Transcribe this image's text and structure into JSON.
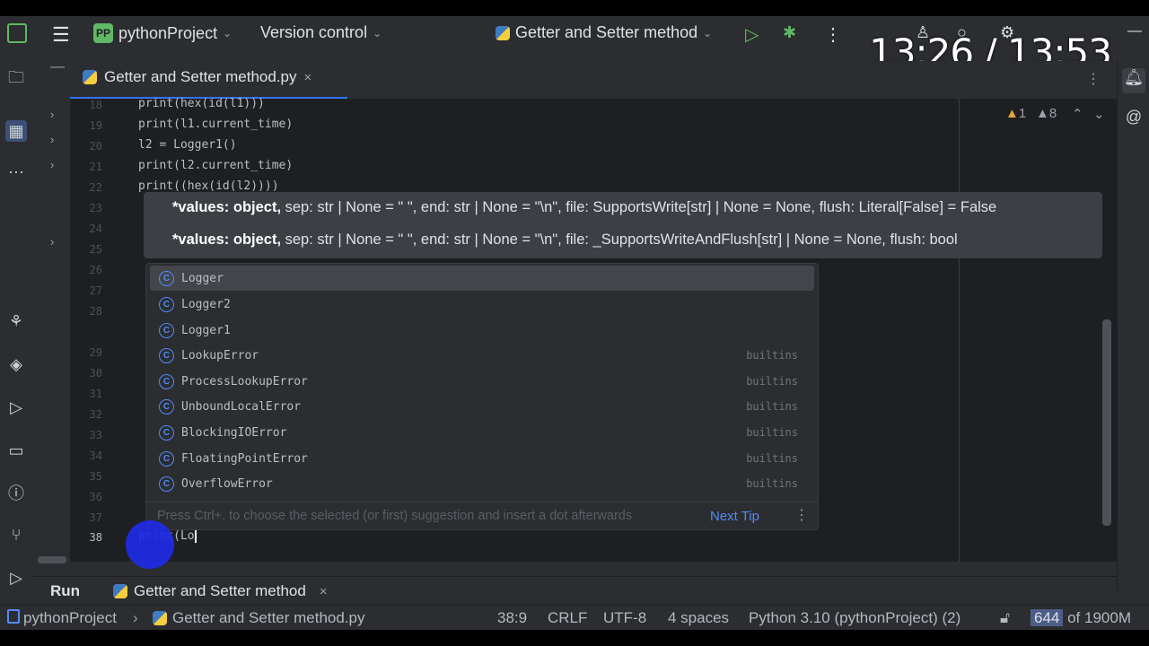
{
  "titlebar": {
    "project_badge": "PP",
    "project_name": "pythonProject",
    "version_control": "Version control",
    "run_config": "Getter and Setter method",
    "timer": "13:26 / 13:53"
  },
  "editor_tab": {
    "label": "Getter and Setter method.py",
    "close": "×"
  },
  "inspections": {
    "warnings": "1",
    "weak_warnings": "8"
  },
  "line_numbers": [
    "18",
    "19",
    "20",
    "21",
    "22",
    "23",
    "24",
    "25",
    "26",
    "27",
    "28",
    "29",
    "30",
    "31",
    "32",
    "33",
    "34",
    "35",
    "36",
    "37",
    "38"
  ],
  "code_lines": [
    "print(hex(id(l1)))",
    "print(l1.current_time)",
    "l2 = Logger1()",
    "print(l2.current_time)",
    "print((hex(id(l2))))"
  ],
  "current_line": {
    "number": "38",
    "text": "print(Lo"
  },
  "param_hint": {
    "line1_bold": "*values: object,",
    "line1_rest": " sep: str | None = \" \", end: str | None = \"\\n\", file: SupportsWrite[str] | None = None, flush: Literal[False] = False",
    "line2_bold": "*values: object,",
    "line2_rest": " sep: str | None = \" \", end: str | None = \"\\n\", file: _SupportsWriteAndFlush[str] | None = None, flush: bool"
  },
  "completion": {
    "items": [
      {
        "name": "Logger",
        "source": ""
      },
      {
        "name": "Logger2",
        "source": ""
      },
      {
        "name": "Logger1",
        "source": ""
      },
      {
        "name": "LookupError",
        "source": "builtins"
      },
      {
        "name": "ProcessLookupError",
        "source": "builtins"
      },
      {
        "name": "UnboundLocalError",
        "source": "builtins"
      },
      {
        "name": "BlockingIOError",
        "source": "builtins"
      },
      {
        "name": "FloatingPointError",
        "source": "builtins"
      },
      {
        "name": "OverflowError",
        "source": "builtins"
      }
    ],
    "class_icon": "C",
    "tip_text": "Press Ctrl+. to choose the selected (or first) suggestion and insert a dot afterwards",
    "tip_link": "Next Tip",
    "more": "⋮"
  },
  "run_panel": {
    "label": "Run",
    "tab": "Getter and Setter method",
    "close": "×"
  },
  "statusbar": {
    "project": "pythonProject",
    "file": "Getter and Setter method.py",
    "position": "38:9",
    "line_sep": "CRLF",
    "encoding": "UTF-8",
    "indent": "4 spaces",
    "interpreter": "Python 3.10 (pythonProject) (2)",
    "memory_used": "644",
    "memory_rest": " of 1900M"
  },
  "colors": {
    "accent": "#3574f0",
    "bg": "#2b2d30",
    "editor_bg": "#1e1f22",
    "link": "#548af7"
  }
}
